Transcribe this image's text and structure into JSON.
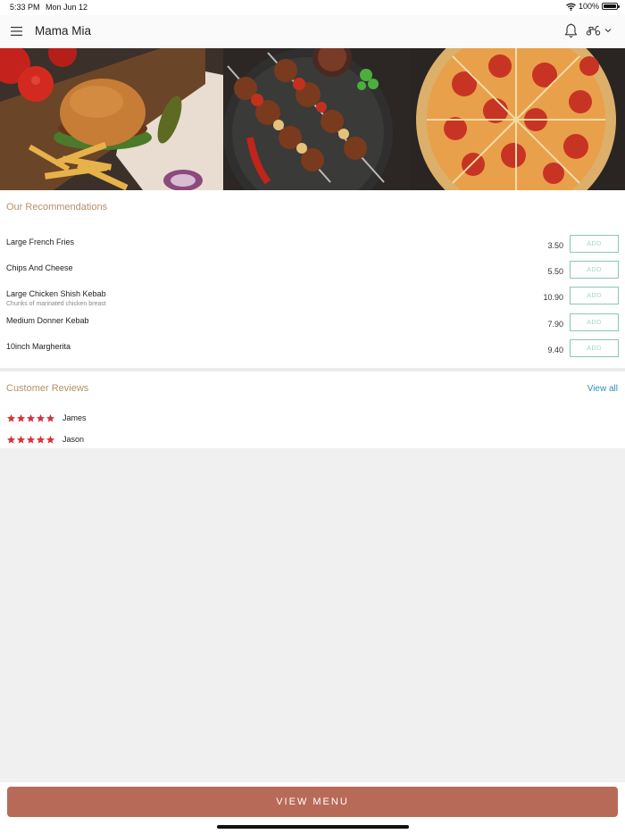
{
  "status_bar": {
    "time": "5:33 PM",
    "date": "Mon Jun 12",
    "battery": "100%",
    "battery_level": 1.0
  },
  "header": {
    "title": "Mama Mia",
    "menu_icon": "hamburger-menu-icon",
    "notification_icon": "bell-icon",
    "delivery_icon": "scooter-icon"
  },
  "recommendations": {
    "title": "Our Recommendations",
    "add_label": "ADD",
    "items": [
      {
        "name": "Large French Fries",
        "description": "",
        "price": "3.50"
      },
      {
        "name": "Chips And Cheese",
        "description": "",
        "price": "5.50"
      },
      {
        "name": "Large Chicken Shish Kebab",
        "description": "Chunks of marinated chicken breast",
        "price": "10.90"
      },
      {
        "name": "Medium Donner Kebab",
        "description": "",
        "price": "7.90"
      },
      {
        "name": "10inch Margherita",
        "description": "",
        "price": "9.40"
      }
    ]
  },
  "reviews": {
    "title": "Customer Reviews",
    "view_all": "View all",
    "items": [
      {
        "name": "James",
        "rating": 5
      },
      {
        "name": "Jason",
        "rating": 5
      }
    ]
  },
  "footer": {
    "view_menu": "VIEW MENU"
  },
  "colors": {
    "accent": "#b86a58",
    "section_title": "#b49166",
    "link": "#2e8fb7",
    "add_border": "#8ac7b2",
    "star": "#d8333a"
  }
}
